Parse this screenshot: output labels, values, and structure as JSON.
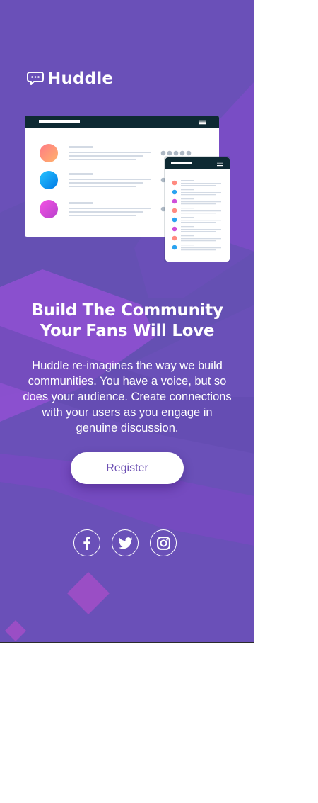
{
  "brand": {
    "name": "Huddle",
    "logo_icon": "chat-bubble-icon"
  },
  "hero": {
    "headline_line1": "Build The Community",
    "headline_line2": "Your Fans Will Love",
    "description": "Huddle re-imagines the way we build communities. You have a voice, but so does your audience. Create connections with your users as you engage in genuine discussion.",
    "cta_label": "Register"
  },
  "social_links": [
    {
      "name": "Facebook",
      "icon": "facebook-icon"
    },
    {
      "name": "Twitter",
      "icon": "twitter-icon"
    },
    {
      "name": "Instagram",
      "icon": "instagram-icon"
    }
  ],
  "colors": {
    "background": "#6a50b8",
    "accent_purple": "#8b46d4",
    "button_text": "#6c4fb3",
    "mockup_header": "#0e2a33",
    "white": "#ffffff"
  }
}
